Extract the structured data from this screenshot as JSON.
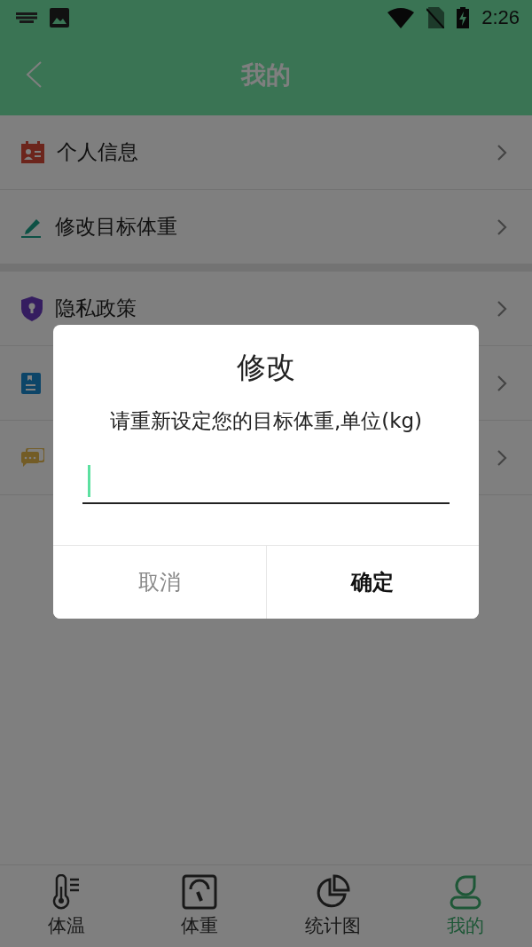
{
  "status_bar": {
    "time": "2:26"
  },
  "header": {
    "title": "我的"
  },
  "menu_groups": [
    [
      {
        "kind": "labeled",
        "label": "个人信息"
      },
      {
        "kind": "labeled",
        "label": "修改目标体重"
      }
    ],
    [
      {
        "kind": "labeled",
        "label": "隐私政策"
      },
      {
        "kind": "covered"
      },
      {
        "kind": "covered"
      }
    ]
  ],
  "dialog": {
    "title": "修改",
    "message": "请重新设定您的目标体重,单位(kg)",
    "buttons": [
      {
        "label": "取消",
        "kind": "cancel"
      },
      {
        "label": "确定",
        "kind": "confirm"
      }
    ]
  },
  "bottom_nav": [
    {
      "label": "体温",
      "selected": false
    },
    {
      "label": "体重",
      "selected": false
    },
    {
      "label": "统计图",
      "selected": false
    },
    {
      "label": "我的",
      "selected": true
    }
  ]
}
